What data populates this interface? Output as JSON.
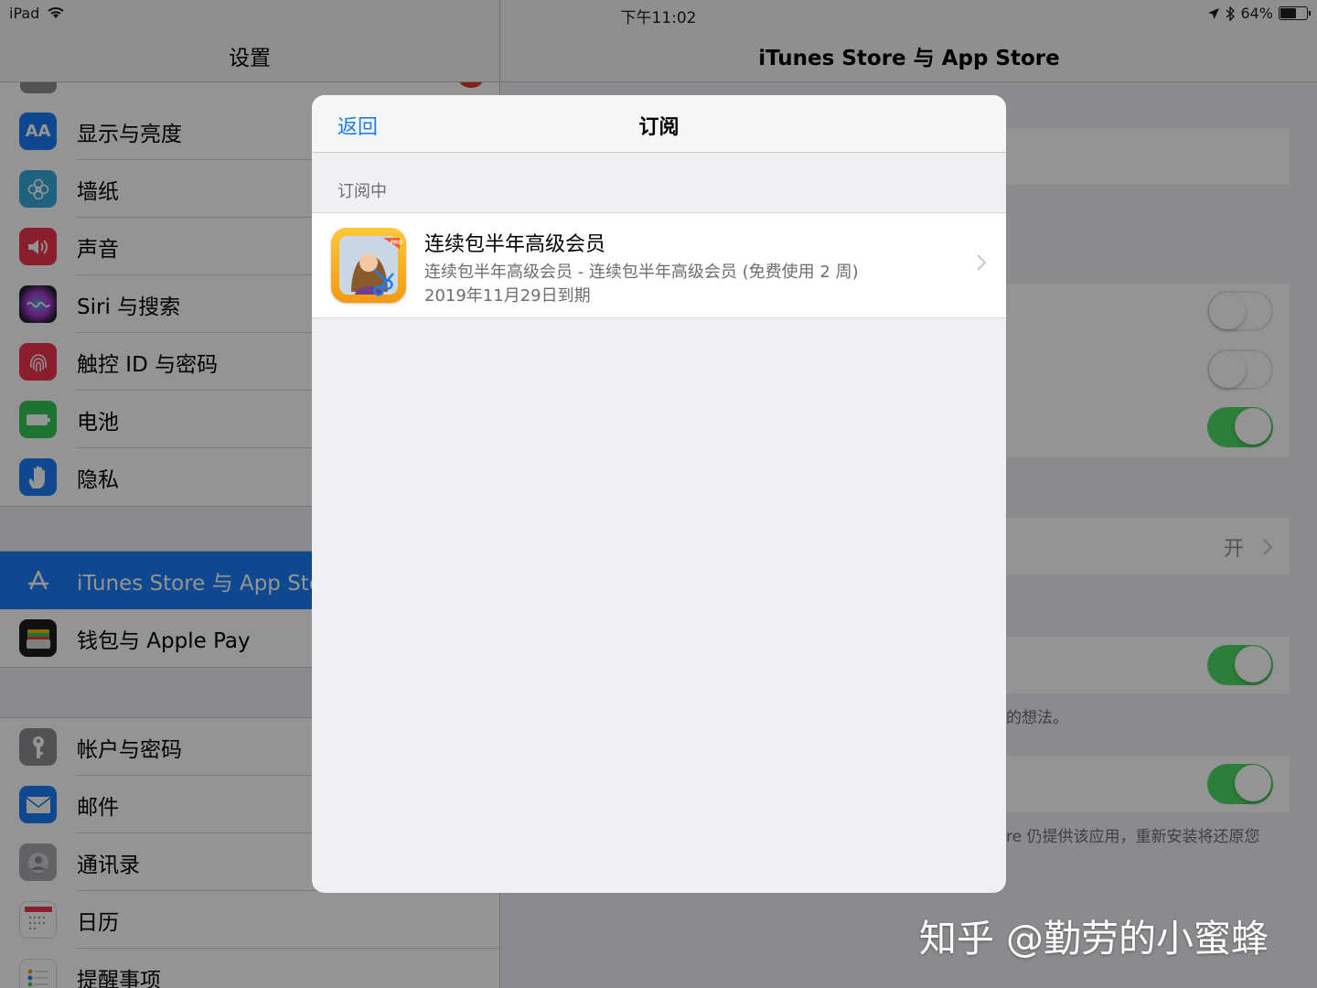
{
  "status_bar": {
    "device": "iPad",
    "time": "下午11:02",
    "battery_text": "64%",
    "battery_level": 0.64
  },
  "sidebar": {
    "title": "设置",
    "groups": [
      [
        {
          "label": "显示与亮度",
          "icon": "text-size-icon",
          "color": "#1a7cf5"
        },
        {
          "label": "墙纸",
          "icon": "flower-icon",
          "color": "#36aadc"
        },
        {
          "label": "声音",
          "icon": "speaker-icon",
          "color": "#f0344e"
        },
        {
          "label": "Siri 与搜索",
          "icon": "siri-icon",
          "color": "#222233"
        },
        {
          "label": "触控 ID 与密码",
          "icon": "fingerprint-icon",
          "color": "#f0344e"
        },
        {
          "label": "电池",
          "icon": "battery-icon",
          "color": "#34c759"
        },
        {
          "label": "隐私",
          "icon": "hand-icon",
          "color": "#1a7cf5"
        }
      ],
      [
        {
          "label": "iTunes Store 与 App Store",
          "icon": "app-store-icon",
          "color": "#1a7cf5",
          "selected": true
        },
        {
          "label": "钱包与 Apple Pay",
          "icon": "wallet-icon",
          "color": "#1c1c1e"
        }
      ],
      [
        {
          "label": "帐户与密码",
          "icon": "key-icon",
          "color": "#8e8e93"
        },
        {
          "label": "邮件",
          "icon": "mail-icon",
          "color": "#1a7cf5"
        },
        {
          "label": "通讯录",
          "icon": "contacts-icon",
          "color": "#a9a9ae"
        },
        {
          "label": "日历",
          "icon": "calendar-icon",
          "color": "#ffffff"
        },
        {
          "label": "提醒事项",
          "icon": "reminders-icon",
          "color": "#ffffff"
        }
      ]
    ]
  },
  "detail": {
    "title": "iTunes Store 与 App Store",
    "toggles": [
      false,
      false,
      true,
      true,
      true
    ],
    "value_label": "开",
    "note_1": "的想法。",
    "note_2": "re 仍提供该应用，重新安装将还原您"
  },
  "modal": {
    "back_label": "返回",
    "title": "订阅",
    "section_header": "订阅中",
    "subscription": {
      "title": "连续包半年高级会员",
      "description": "连续包半年高级会员 - 连续包半年高级会员 (免费使用 2 周)",
      "expiry": "2019年11月29日到期",
      "badge": "PRO"
    }
  },
  "watermark": "知乎 @勤劳的小蜜蜂",
  "colors": {
    "accent": "#1a7cf5",
    "toggle_on": "#4cd964",
    "badge_red": "#e23a2c"
  }
}
